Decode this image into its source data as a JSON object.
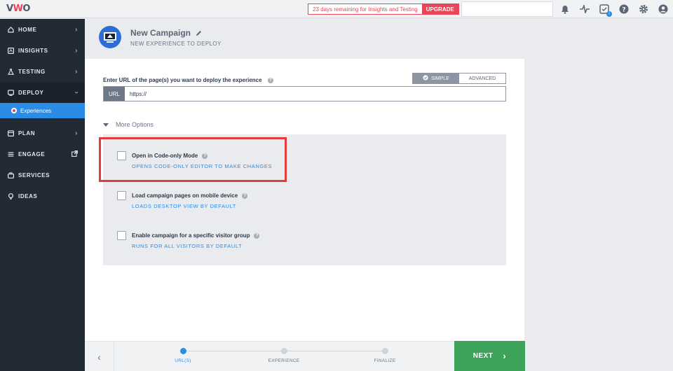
{
  "app": {
    "logo": "VWO"
  },
  "topbar": {
    "trial_text": "23 days remaining for Insights and Testing",
    "upgrade_label": "UPGRADE",
    "icons": [
      "bell-icon",
      "activity-icon",
      "guide-icon",
      "help-icon",
      "settings-icon",
      "user-icon"
    ]
  },
  "sidebar": {
    "items": [
      {
        "label": "HOME",
        "icon": "home-icon"
      },
      {
        "label": "INSIGHTS",
        "icon": "insights-icon"
      },
      {
        "label": "TESTING",
        "icon": "flask-icon"
      },
      {
        "label": "DEPLOY",
        "icon": "deploy-icon"
      },
      {
        "label": "PLAN",
        "icon": "plan-icon"
      },
      {
        "label": "ENGAGE",
        "icon": "engage-icon"
      },
      {
        "label": "SERVICES",
        "icon": "services-icon"
      },
      {
        "label": "IDEAS",
        "icon": "bulb-icon"
      }
    ],
    "sub_active": "Experiences"
  },
  "header": {
    "title": "New Campaign",
    "subtitle": "NEW EXPERIENCE TO DEPLOY"
  },
  "url_section": {
    "label": "Enter URL of the page(s) you want to deploy the experience",
    "mode_simple": "SIMPLE",
    "mode_advanced": "ADVANCED",
    "url_tag": "URL",
    "url_value": "https://"
  },
  "more_options": {
    "label": "More Options",
    "options": [
      {
        "title": "Open in Code-only Mode",
        "subtitle": "OPENS CODE-ONLY EDITOR TO MAKE CHANGES",
        "checked": false
      },
      {
        "title": "Load campaign pages on mobile device",
        "subtitle": "LOADS DESKTOP VIEW BY DEFAULT",
        "checked": false
      },
      {
        "title": "Enable campaign for a specific visitor group",
        "subtitle": "RUNS FOR ALL VISITORS BY DEFAULT",
        "checked": false
      }
    ]
  },
  "stepper": {
    "steps": [
      "URL(S)",
      "EXPERIENCE",
      "FINALIZE"
    ],
    "active_step": 0,
    "next_label": "NEXT"
  },
  "colors": {
    "accent": "#2b8ce6",
    "next": "#3ea35a",
    "upgrade": "#e8455a",
    "highlight": "#e23b3b"
  }
}
